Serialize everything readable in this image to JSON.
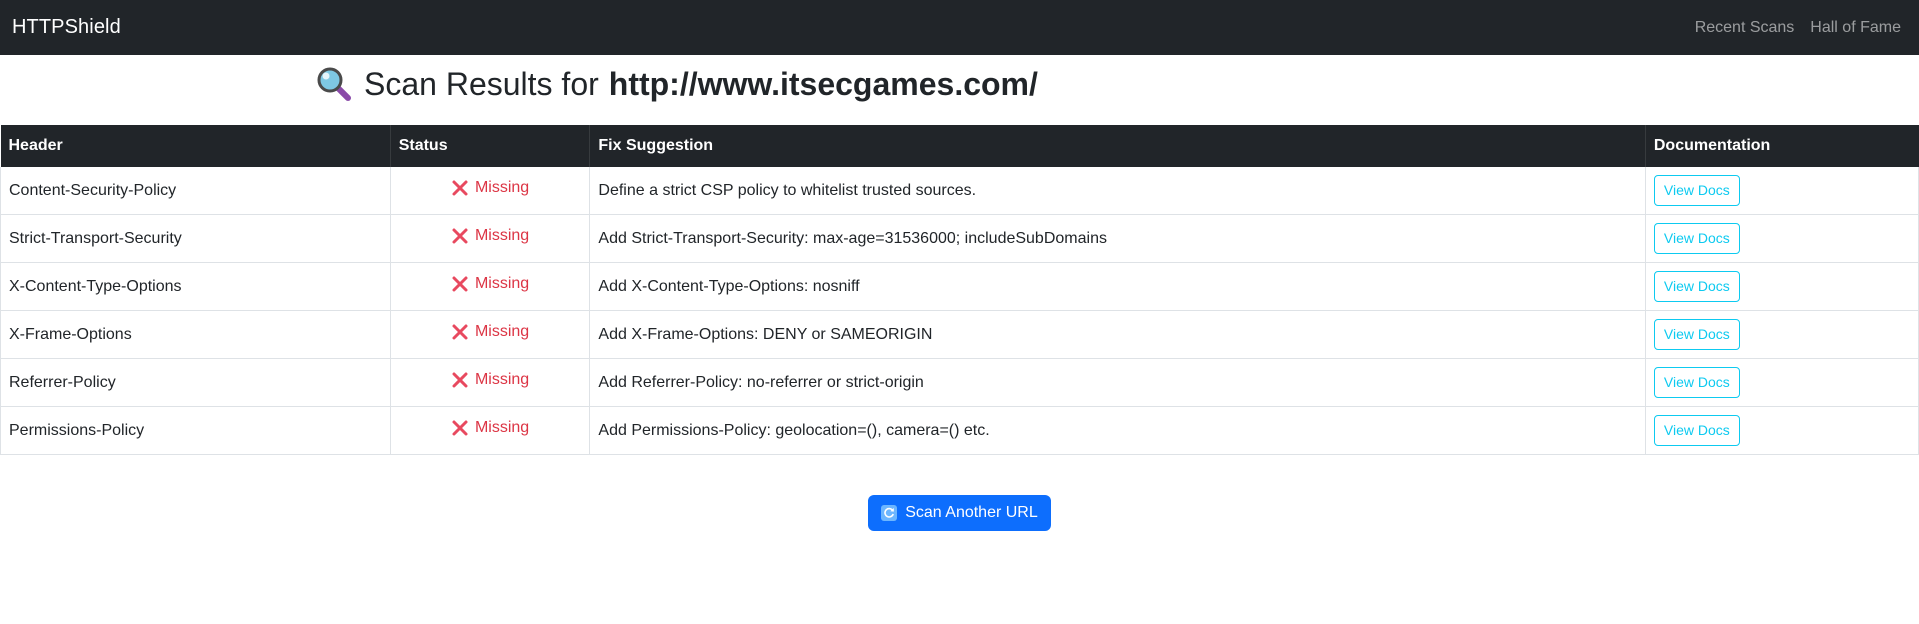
{
  "navbar": {
    "brand": "HTTPShield",
    "links": [
      "Recent Scans",
      "Hall of Fame"
    ]
  },
  "page": {
    "title_prefix": "Scan Results for",
    "title_url": "http://www.itsecgames.com/",
    "title_icon": "magnifying-glass-icon"
  },
  "table": {
    "columns": [
      "Header",
      "Status",
      "Fix Suggestion",
      "Documentation"
    ],
    "rows": [
      {
        "header": "Content-Security-Policy",
        "status": "Missing",
        "fix": "Define a strict CSP policy to whitelist trusted sources.",
        "doc": "View Docs"
      },
      {
        "header": "Strict-Transport-Security",
        "status": "Missing",
        "fix": "Add Strict-Transport-Security: max-age=31536000; includeSubDomains",
        "doc": "View Docs"
      },
      {
        "header": "X-Content-Type-Options",
        "status": "Missing",
        "fix": "Add X-Content-Type-Options: nosniff",
        "doc": "View Docs"
      },
      {
        "header": "X-Frame-Options",
        "status": "Missing",
        "fix": "Add X-Frame-Options: DENY or SAMEORIGIN",
        "doc": "View Docs"
      },
      {
        "header": "Referrer-Policy",
        "status": "Missing",
        "fix": "Add Referrer-Policy: no-referrer or strict-origin",
        "doc": "View Docs"
      },
      {
        "header": "Permissions-Policy",
        "status": "Missing",
        "fix": "Add Permissions-Policy: geolocation=(), camera=() etc.",
        "doc": "View Docs"
      }
    ]
  },
  "actions": {
    "scan_another": "Scan Another URL",
    "scan_icon": "refresh-icon"
  },
  "colors": {
    "navbar_bg": "#212529",
    "missing": "#dc3545",
    "info": "#0dcaf0",
    "primary": "#0d6efd"
  }
}
